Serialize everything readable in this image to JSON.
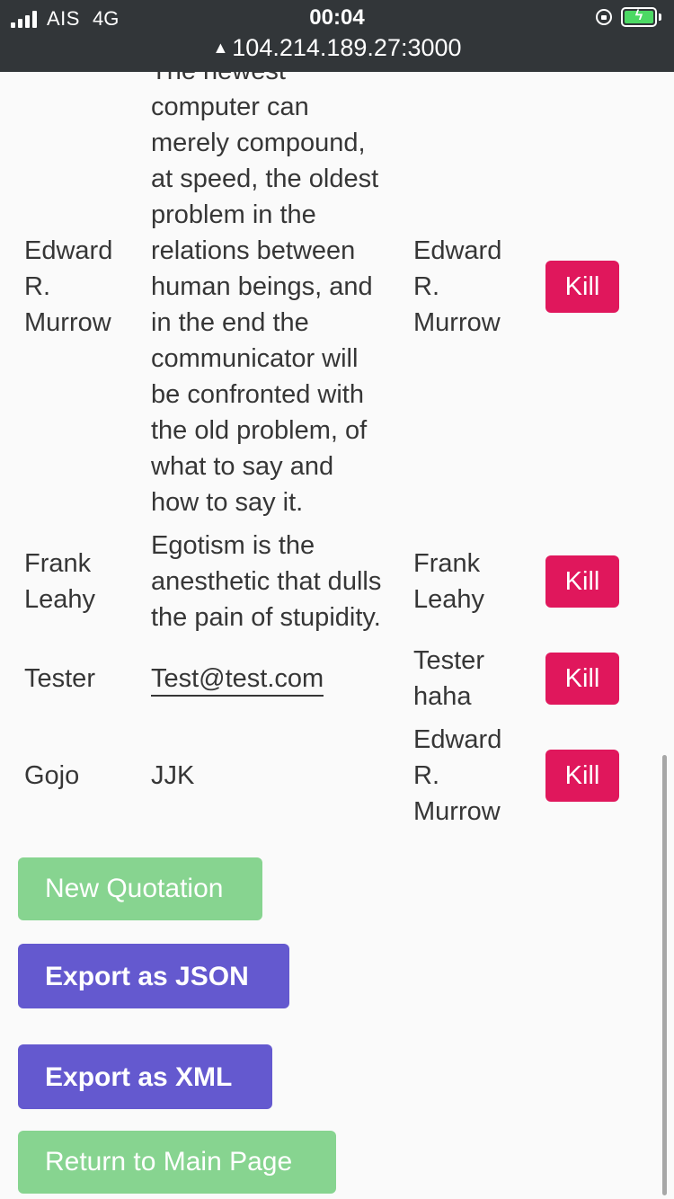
{
  "status_bar": {
    "carrier": "AIS",
    "network": "4G",
    "time": "00:04",
    "url": "104.214.189.27:3000",
    "warning_icon": "warning-triangle-icon",
    "battery_color": "#4cd964"
  },
  "rows": [
    {
      "author": "Edward R. Murrow",
      "quote": "The newest computer can merely compound, at speed, the oldest problem in the relations between human beings, and in the end the communicator will be confronted with the old problem, of what to say and how to say it.",
      "quote_lines": [
        "The newest",
        "computer can",
        "merely compound,",
        "at speed, the oldest",
        "problem in the",
        "relations between",
        "human beings, and",
        "in the end the",
        "communicator will",
        "be confronted with",
        "the old problem, of",
        "what to say and",
        "how to say it."
      ],
      "added_by": "Edward R. Murrow",
      "action": "Kill"
    },
    {
      "author": "Frank Leahy",
      "quote": "Egotism is the anesthetic that dulls the pain of stupidity.",
      "quote_lines": [
        "Egotism is the",
        "anesthetic that dulls",
        "the pain of stupidity."
      ],
      "added_by": "Frank Leahy",
      "action": "Kill"
    },
    {
      "author": "Tester",
      "quote": "Test@test.com",
      "added_by": "Tester haha",
      "action": "Kill"
    },
    {
      "author": "Gojo",
      "quote": "JJK",
      "added_by": "Edward R. Murrow",
      "action": "Kill"
    }
  ],
  "buttons": {
    "new_quotation": "New Quotation",
    "export_json": "Export as JSON",
    "export_xml": "Export as XML",
    "return_main": "Return to Main Page"
  },
  "colors": {
    "kill": "#e0175c",
    "green_button": "#87d490",
    "purple_button": "#6459cf",
    "status_bar": "#323639"
  }
}
